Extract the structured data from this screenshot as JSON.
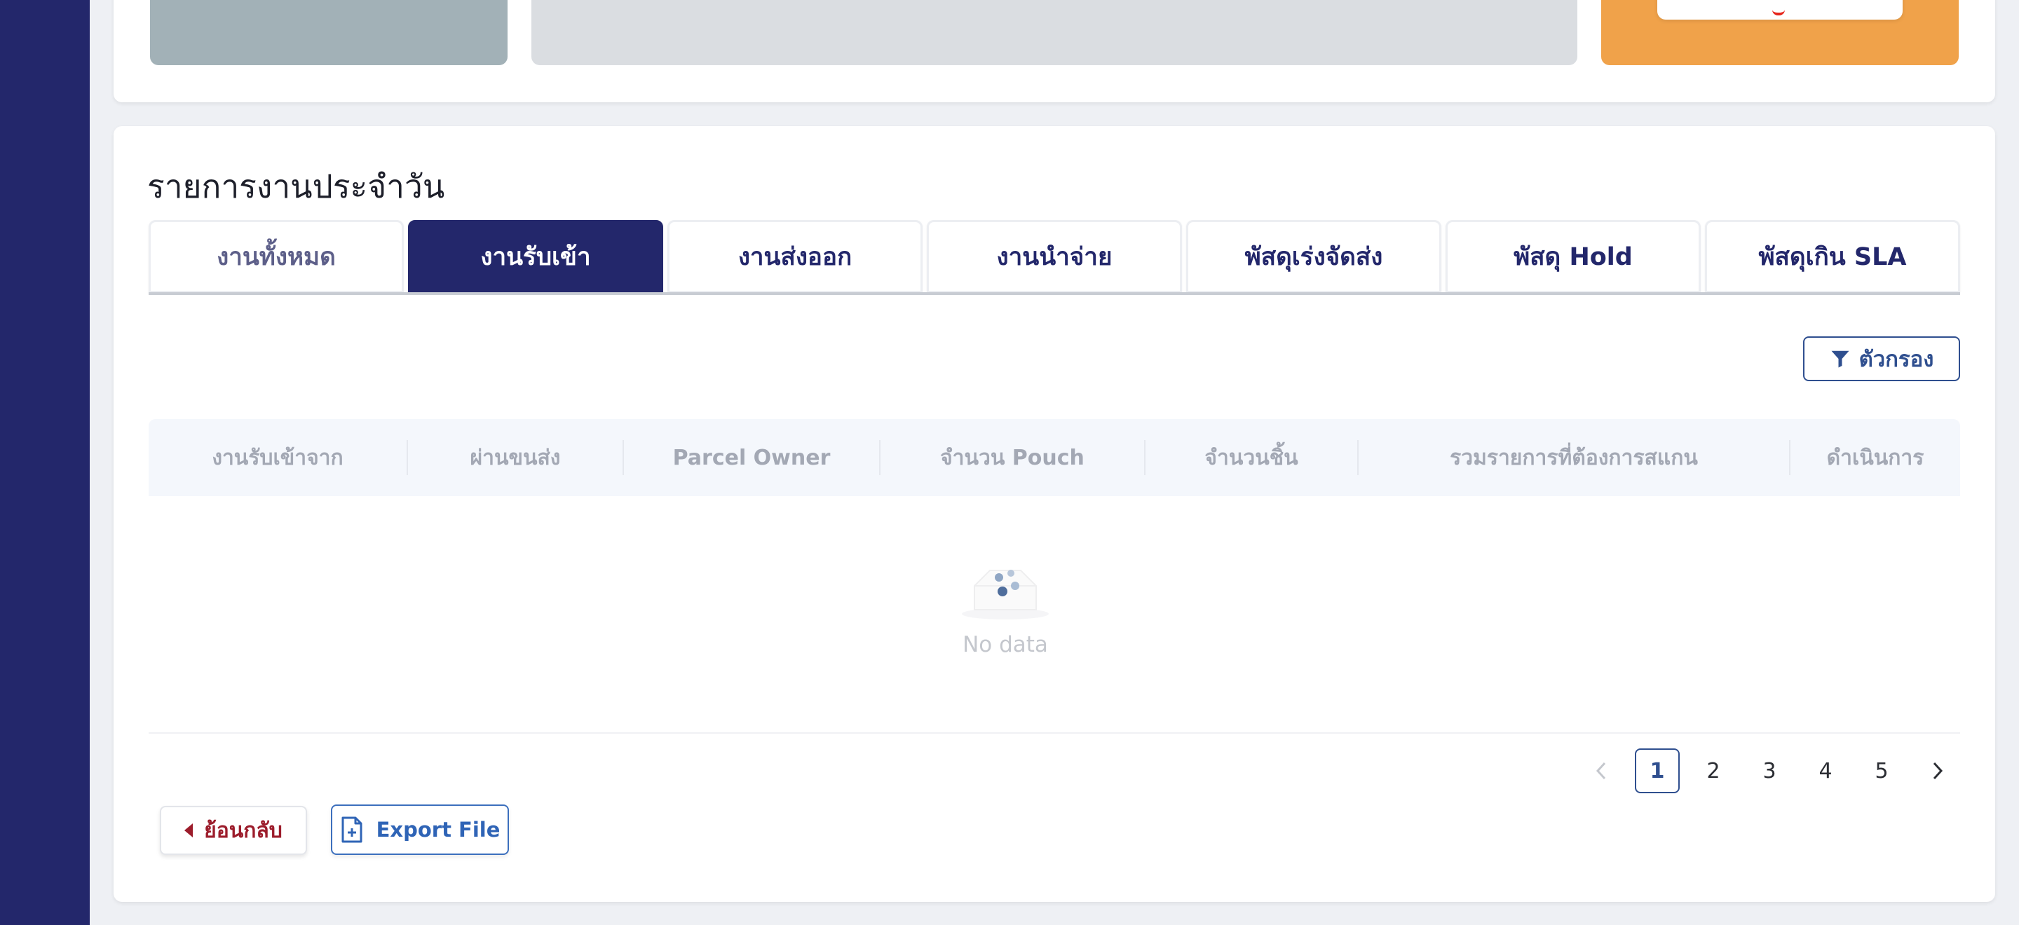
{
  "section_title": "รายการงานประจำวัน",
  "tabs": [
    {
      "label": "งานทั้งหมด"
    },
    {
      "label": "งานรับเข้า"
    },
    {
      "label": "งานส่งออก"
    },
    {
      "label": "งานนำจ่าย"
    },
    {
      "label": "พัสดุเร่งจัดส่ง"
    },
    {
      "label": "พัสดุ Hold"
    },
    {
      "label": "พัสดุเกิน SLA"
    }
  ],
  "active_tab": "งานรับเข้า",
  "filter_label": "ตัวกรอง",
  "table": {
    "columns": [
      "งานรับเข้าจาก",
      "ผ่านขนส่ง",
      "Parcel Owner",
      "จำนวน Pouch",
      "จำนวนชิ้น",
      "รวมรายการที่ต้องการสแกน",
      "ดำเนินการ"
    ],
    "empty_text": "No data"
  },
  "pagination": {
    "pages": [
      "1",
      "2",
      "3",
      "4",
      "5"
    ],
    "current": "1",
    "prev_icon": "chevron-left-icon",
    "next_icon": "chevron-right-icon"
  },
  "back_label": "ย้อนกลับ",
  "export_label": "Export File",
  "colors": {
    "sidebar": "#23276b",
    "active_tab": "#23276b",
    "orange_card": "#f0a24a",
    "back_text": "#9c1c2b",
    "export_text": "#2f64b6"
  }
}
